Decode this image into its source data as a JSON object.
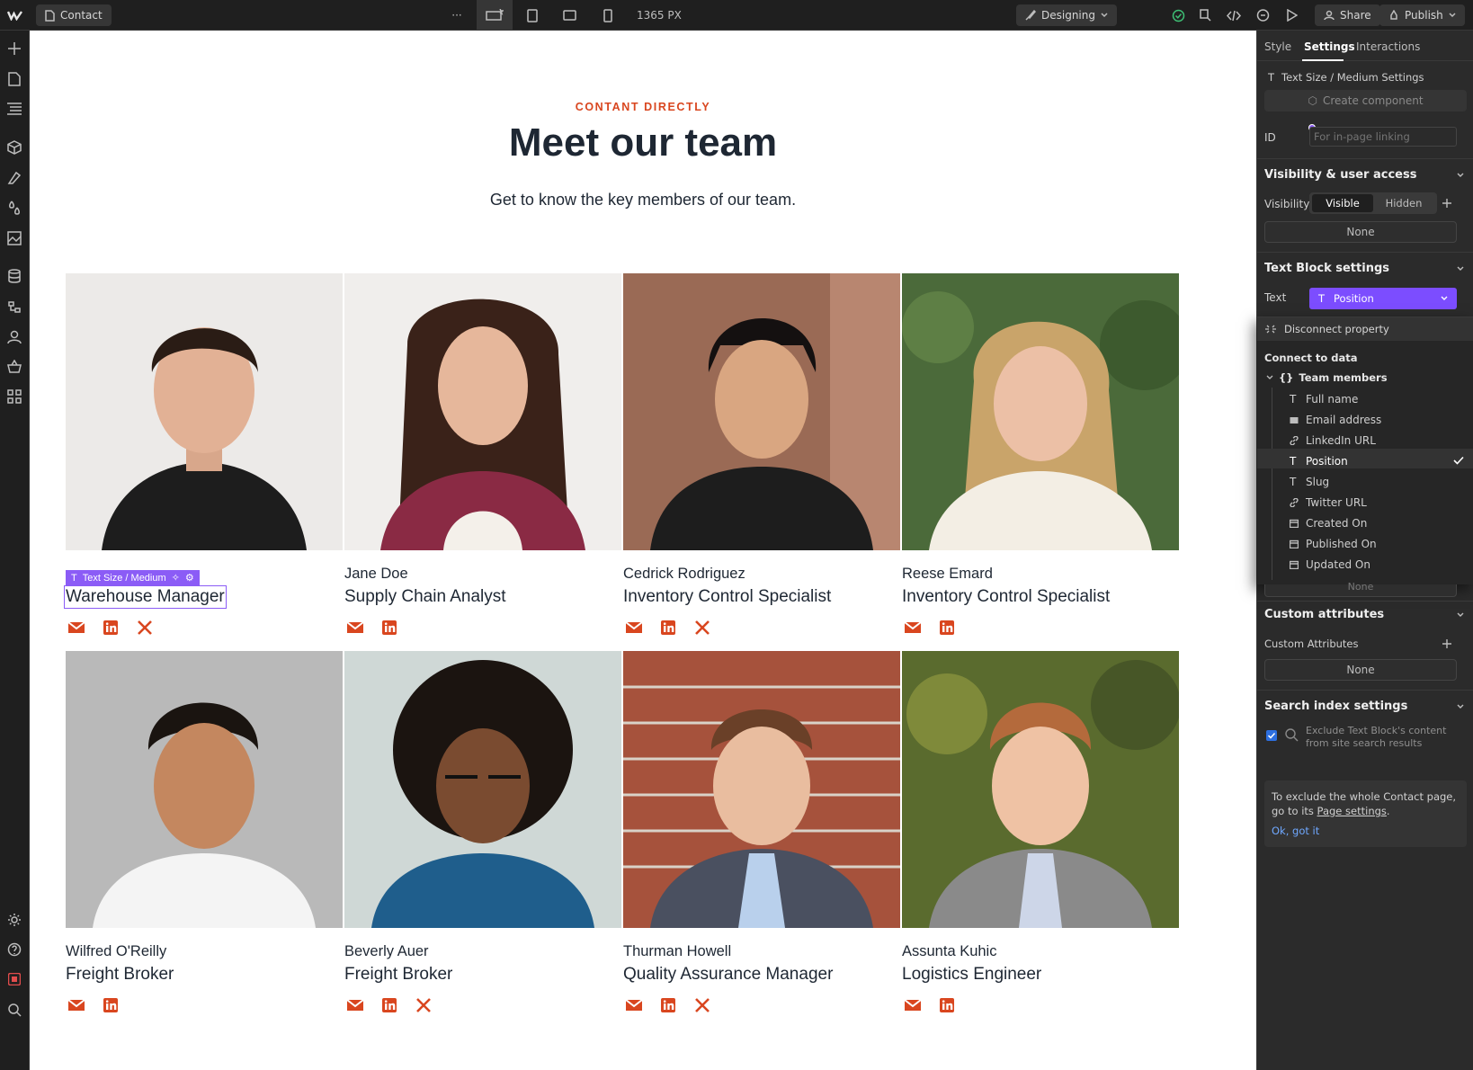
{
  "topbar": {
    "page_name": "Contact",
    "more_label": "···",
    "width_readout": "1365 PX",
    "mode_label": "Designing",
    "share_label": "Share",
    "publish_label": "Publish"
  },
  "canvas": {
    "eyebrow": "CONTANT DIRECTLY",
    "title": "Meet our team",
    "subtitle": "Get to know the key members of our team.",
    "selection_tag": "Text Size / Medium",
    "members": [
      {
        "name": "",
        "role": "Warehouse Manager",
        "twitter": true
      },
      {
        "name": "Jane Doe",
        "role": "Supply Chain Analyst",
        "twitter": false
      },
      {
        "name": "Cedrick Rodriguez",
        "role": "Inventory Control Specialist",
        "twitter": true
      },
      {
        "name": "Reese Emard",
        "role": "Inventory Control Specialist",
        "twitter": false
      },
      {
        "name": "Wilfred O'Reilly",
        "role": "Freight Broker",
        "twitter": false
      },
      {
        "name": "Beverly Auer",
        "role": "Freight Broker",
        "twitter": true
      },
      {
        "name": "Thurman Howell",
        "role": "Quality Assurance Manager",
        "twitter": true
      },
      {
        "name": "Assunta Kuhic",
        "role": "Logistics Engineer",
        "twitter": false
      }
    ],
    "accent_color": "#d9461f"
  },
  "panel": {
    "tabs": [
      "Style",
      "Settings",
      "Interactions"
    ],
    "active_tab": "Settings",
    "breadcrumb": "Text Size / Medium Settings",
    "create_component": "Create component",
    "id_label": "ID",
    "id_placeholder": "For in-page linking",
    "visibility_section": "Visibility & user access",
    "visibility_label": "Visibility",
    "visible_label": "Visible",
    "hidden_label": "Hidden",
    "none_label": "None",
    "textblock_section": "Text Block settings",
    "text_label": "Text",
    "text_value": "Position",
    "disconnect_label": "Disconnect property",
    "connect_label": "Connect to data",
    "collection_label": "Team members",
    "fields": [
      {
        "label": "Full name",
        "icon": "text-icon"
      },
      {
        "label": "Email address",
        "icon": "mail-icon"
      },
      {
        "label": "LinkedIn URL",
        "icon": "link-icon"
      },
      {
        "label": "Position",
        "icon": "text-icon",
        "selected": true
      },
      {
        "label": "Slug",
        "icon": "text-icon"
      },
      {
        "label": "Twitter URL",
        "icon": "link-icon"
      },
      {
        "label": "Created On",
        "icon": "calendar-icon"
      },
      {
        "label": "Published On",
        "icon": "calendar-icon"
      },
      {
        "label": "Updated On",
        "icon": "calendar-icon"
      }
    ],
    "custom_attr_section": "Custom attributes",
    "custom_attr_label": "Custom Attributes",
    "search_section": "Search index settings",
    "exclude_text": "Exclude Text Block's content from site search results",
    "tip_text_1": "To exclude the whole Contact page, go to its ",
    "tip_link": "Page settings",
    "tip_text_2": ".",
    "tip_ok": "Ok, got it",
    "accent_color": "#8b5cf6"
  }
}
